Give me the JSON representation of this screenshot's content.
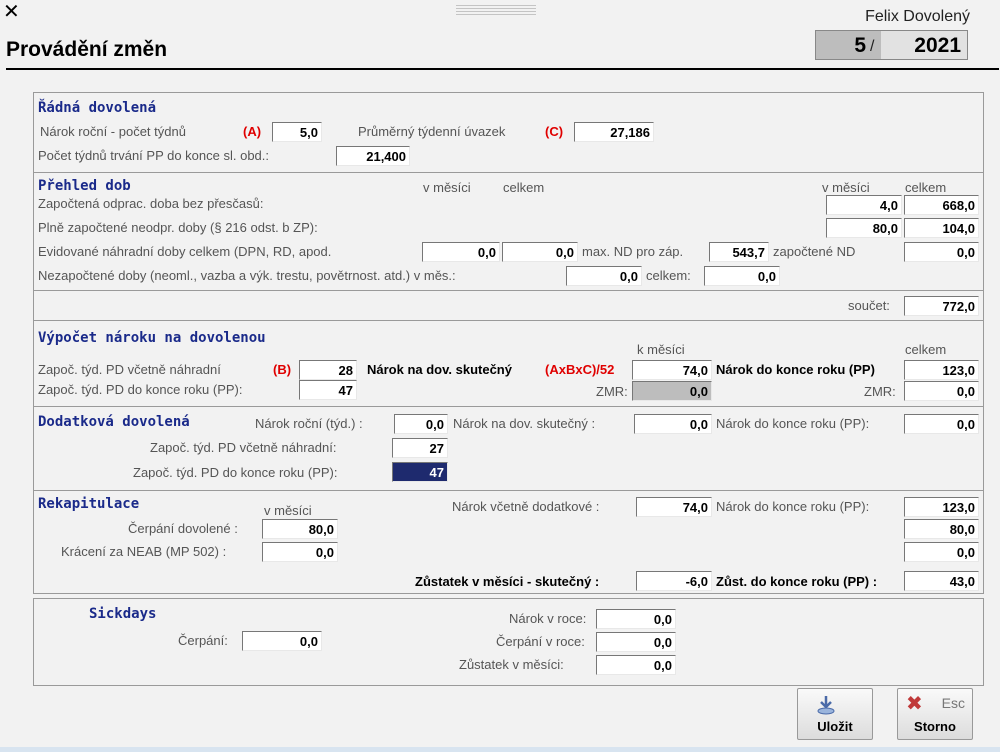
{
  "window": {
    "close_glyph": "✕",
    "user_name": "Felix Dovolený",
    "title": "Provádění změn",
    "period_month": "5",
    "period_sep": "/",
    "period_year": "2021"
  },
  "radna": {
    "title": "Řádná dovolená",
    "narok_label": "Nárok roční - počet týdnů",
    "narok_code": "(A)",
    "narok_value": "5,0",
    "uvazek_label": "Průměrný týdenní úvazek",
    "uvazek_code": "(C)",
    "uvazek_value": "27,186",
    "pocet_label": "Počet týdnů trvání PP do konce sl. obd.:",
    "pocet_value": "21,400"
  },
  "prehled": {
    "title": "Přehled dob",
    "col_month": "v měsíci",
    "col_total": "celkem",
    "col_month2": "v měsíci",
    "col_total2": "celkem",
    "row1_label": "Započtená odprac. doba bez přesčasů:",
    "row1_month": "4,0",
    "row1_total": "668,0",
    "row2_label": "Plně započtené neodpr. doby (§ 216 odst. b ZP):",
    "row2_month": "80,0",
    "row2_total": "104,0",
    "row3_label": "Evidované náhradní doby celkem (DPN, RD, apod.",
    "row3_month": "0,0",
    "row3_total": "0,0",
    "row3_maxnd_label": "max. ND pro záp.",
    "row3_maxnd_value": "543,7",
    "row3_zapnd_label": "započtené ND",
    "row3_zapnd_value": "0,0",
    "row4_label": "Nezapočtené doby (neoml., vazba a výk. trestu, povětrnost. atd.) v měs.:",
    "row4_month": "0,0",
    "row4_total_label": "celkem:",
    "row4_total": "0,0",
    "soucet_label": "součet:",
    "soucet_value": "772,0"
  },
  "vypocet": {
    "title": "Výpočet nároku na dovolenou",
    "k_mesici": "k měsíci",
    "celkem": "celkem",
    "r1_label": "Započ. týd. PD včetně náhradní",
    "r1_code": "(B)",
    "r1_value": "28",
    "nsk_label": "Nárok na dov. skutečný",
    "nsk_code": "(AxBxC)/52",
    "nsk_value": "74,0",
    "ndk_label": "Nárok do konce roku (PP)",
    "ndk_value": "123,0",
    "r2_label": "Započ. týd. PD do konce roku (PP):",
    "r2_value": "47",
    "zmr_label": "ZMR:",
    "zmr_value": "0,0",
    "zmr2_label": "ZMR:",
    "zmr2_value": "0,0"
  },
  "dodatkova": {
    "title": "Dodatková dovolená",
    "narok_label": "Nárok roční (týd.) :",
    "narok_value": "0,0",
    "nsk_label": "Nárok na dov. skutečný :",
    "nsk_value": "0,0",
    "ndk_label": "Nárok do konce roku (PP):",
    "ndk_value": "0,0",
    "r1_label": "Započ. týd. PD včetně náhradní:",
    "r1_value": "27",
    "r2_label": "Započ. týd. PD do konce roku (PP):",
    "r2_value": "47"
  },
  "rekap": {
    "title": "Rekapitulace",
    "v_mesici": "v měsíci",
    "cerp_label": "Čerpání dovolené :",
    "cerp_value": "80,0",
    "krac_label": "Krácení za NEAB (MP 502) :",
    "krac_value": "0,0",
    "nvd_label": "Nárok včetně dodatkové :",
    "nvd_value": "74,0",
    "ndk_label": "Nárok do konce roku (PP):",
    "ndk_value": "123,0",
    "cerp_total": "80,0",
    "krac_total": "0,0",
    "zust_label": "Zůstatek v měsíci - skutečný :",
    "zust_value": "-6,0",
    "zustk_label": "Zůst. do konce roku (PP) :",
    "zustk_value": "43,0"
  },
  "sick": {
    "title": "Sickdays",
    "cerp_label": "Čerpání:",
    "cerp_value": "0,0",
    "narok_label": "Nárok v roce:",
    "narok_value": "0,0",
    "cerpr_label": "Čerpání v roce:",
    "cerpr_value": "0,0",
    "zust_label": "Zůstatek v měsíci:",
    "zust_value": "0,0"
  },
  "buttons": {
    "save_label": "Uložit",
    "storno_label": "Storno",
    "esc_label": "Esc"
  }
}
